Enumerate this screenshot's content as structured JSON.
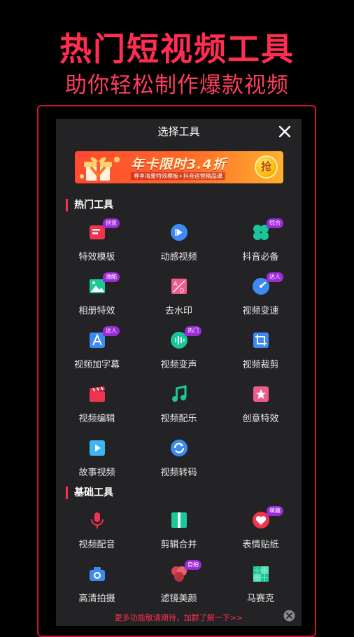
{
  "hero": {
    "title": "热门短视频工具",
    "subtitle": "助你轻松制作爆款视频"
  },
  "panel": {
    "title": "选择工具",
    "close_icon": "close-icon"
  },
  "banner": {
    "title": "年卡限时3.4折",
    "desc": "尊享海量特效模板+抖音运营精品课",
    "coin_label": "抢"
  },
  "sections": {
    "hot": {
      "title": "热门工具",
      "items": [
        {
          "label": "特效模板",
          "badge": "创意",
          "icon": "template-icon",
          "color": "#f0334f"
        },
        {
          "label": "动感视频",
          "badge": "",
          "icon": "play-circle-icon",
          "color": "#3d8bf2"
        },
        {
          "label": "抖音必备",
          "badge": "综合",
          "icon": "clover-icon",
          "color": "#19c59a"
        },
        {
          "label": "相册特效",
          "badge": "潮酷",
          "icon": "album-icon",
          "color": "#1ec79a"
        },
        {
          "label": "去水印",
          "badge": "",
          "icon": "watermark-icon",
          "color": "#f05b8e"
        },
        {
          "label": "视频变速",
          "badge": "达人",
          "icon": "speed-icon",
          "color": "#3d8bf2"
        },
        {
          "label": "视频加字幕",
          "badge": "达人",
          "icon": "subtitle-icon",
          "color": "#3d8bf2"
        },
        {
          "label": "视频变声",
          "badge": "热门",
          "icon": "voice-wave-icon",
          "color": "#19c59a"
        },
        {
          "label": "视频裁剪",
          "badge": "",
          "icon": "crop-icon",
          "color": "#3d8bf2"
        },
        {
          "label": "视频编辑",
          "badge": "",
          "icon": "clapper-icon",
          "color": "#f0334f"
        },
        {
          "label": "视频配乐",
          "badge": "",
          "icon": "music-note-icon",
          "color": "#1ec79a"
        },
        {
          "label": "创意特效",
          "badge": "",
          "icon": "star-frame-icon",
          "color": "#f05b8e"
        },
        {
          "label": "故事视频",
          "badge": "",
          "icon": "story-play-icon",
          "color": "#3db6f2"
        },
        {
          "label": "视频转码",
          "badge": "",
          "icon": "convert-icon",
          "color": "#3d8bf2"
        }
      ]
    },
    "basic": {
      "title": "基础工具",
      "items": [
        {
          "label": "视频配音",
          "badge": "",
          "icon": "microphone-icon",
          "color": "#f0334f"
        },
        {
          "label": "剪辑合并",
          "badge": "",
          "icon": "merge-icon",
          "color": "#1ec79a"
        },
        {
          "label": "表情贴纸",
          "badge": "萌趣",
          "icon": "heart-sticker-icon",
          "color": "#f0334f"
        },
        {
          "label": "高清拍摄",
          "badge": "",
          "icon": "camera-icon",
          "color": "#3d8bf2"
        },
        {
          "label": "滤镜美颜",
          "badge": "自拍",
          "icon": "filter-icon",
          "color": "#d94350"
        },
        {
          "label": "马赛克",
          "badge": "",
          "icon": "mosaic-icon",
          "color": "#1ec79a"
        }
      ]
    }
  },
  "footer": {
    "text": "更多功能敬请期待，加群了解一下>>",
    "close_icon": "close-circle-icon"
  }
}
